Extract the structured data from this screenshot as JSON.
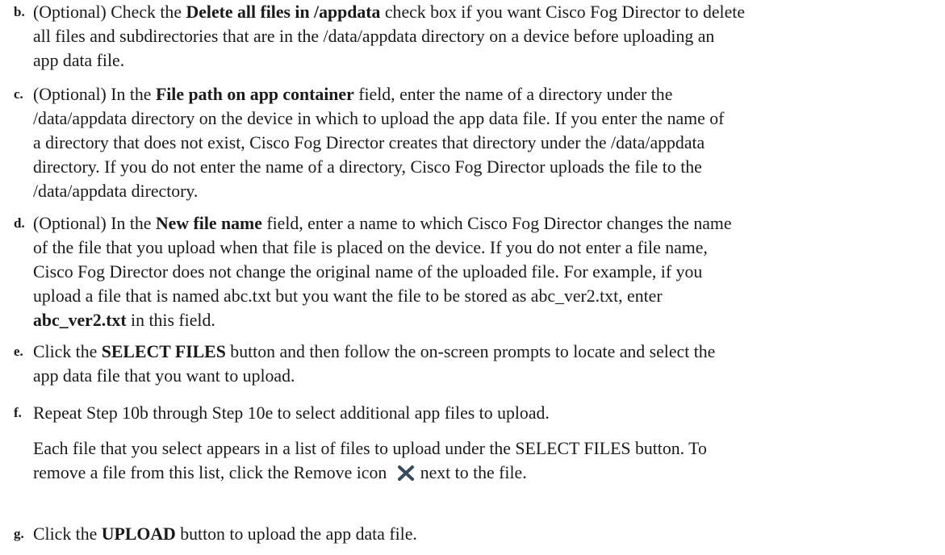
{
  "steps": [
    {
      "marker": "b.",
      "segments": [
        {
          "t": "(Optional) Check the ",
          "b": false
        },
        {
          "t": "Delete all files in /appdata",
          "b": true
        },
        {
          "t": " check box if you want Cisco Fog Director to delete",
          "b": false
        },
        {
          "t": "all files and subdirectories that are in the /data/appdata directory on a device before uploading an",
          "b": false
        },
        {
          "t": "app data file.",
          "b": false
        }
      ]
    },
    {
      "marker": "c.",
      "segments": [
        {
          "t": "(Optional) In the ",
          "b": false
        },
        {
          "t": "File path on app container",
          "b": true
        },
        {
          "t": " field, enter the name of a directory under the",
          "b": false
        },
        {
          "t": "/data/appdata directory on the device in which to upload the app data file. If you enter the name of",
          "b": false
        },
        {
          "t": "a directory that does not exist, Cisco Fog Director creates that directory under the /data/appdata",
          "b": false
        },
        {
          "t": "directory. If you do not enter the name of a directory, Cisco Fog Director uploads the file to the",
          "b": false
        },
        {
          "t": "/data/appdata directory.",
          "b": false
        }
      ]
    },
    {
      "marker": "d.",
      "segments": [
        {
          "t": "(Optional) In the ",
          "b": false
        },
        {
          "t": "New file name",
          "b": true
        },
        {
          "t": " field, enter a name to which Cisco Fog Director changes the name",
          "b": false
        },
        {
          "t": "of the file that you upload when that file is placed on the device. If you do not enter a file name,",
          "b": false
        },
        {
          "t": "Cisco Fog Director does not change the original name of the uploaded file. For example, if you",
          "b": false
        },
        {
          "t": "upload a file that is named abc.txt but you want the file to be stored as abc_ver2.txt, enter",
          "b": false
        },
        {
          "t": "abc_ver2.txt",
          "b": true
        },
        {
          "t": " in this field.",
          "b": false
        }
      ]
    },
    {
      "marker": "e.",
      "segments": [
        {
          "t": "Click the ",
          "b": false
        },
        {
          "t": "SELECT FILES",
          "b": true
        },
        {
          "t": " button and then follow the on-screen prompts to locate and select the",
          "b": false
        },
        {
          "t": "app data file that you want to upload.",
          "b": false
        }
      ]
    },
    {
      "marker": "f.",
      "segments": [
        {
          "t": "Repeat Step 10b through Step 10e to select additional app files to upload.",
          "b": false
        },
        {
          "t": "Each file that you select appears in a list of files to upload under the SELECT FILES button. To",
          "b": false
        },
        {
          "t": "remove a file from this list, click the Remove icon",
          "b": false
        },
        {
          "t": "next to the file.",
          "b": false
        }
      ]
    },
    {
      "marker": "g.",
      "segments": [
        {
          "t": "Click the ",
          "b": false
        },
        {
          "t": "UPLOAD",
          "b": true
        },
        {
          "t": " button to upload the app data file.",
          "b": false
        }
      ]
    }
  ],
  "icons": {
    "remove": "remove-x-icon"
  },
  "colors": {
    "text": "#1a1a1a",
    "icon": "#3a4a5a"
  }
}
